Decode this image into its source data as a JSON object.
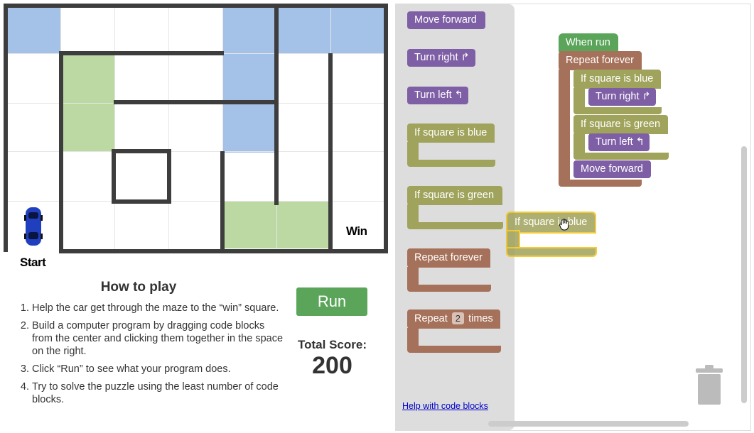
{
  "maze": {
    "start_label": "Start",
    "win_label": "Win",
    "colors": {
      "blue": "#a4c2e8",
      "green": "#bcd9a3",
      "wall": "#3d3d3d",
      "car": "#1f3fbf"
    }
  },
  "instructions": {
    "title": "How to play",
    "steps": [
      "Help the car get through the maze to the “win” square.",
      "Build a computer program by dragging code blocks from the center and clicking them together in the space on the right.",
      "Click “Run” to see what your program does.",
      "Try to solve the puzzle using the least number of code blocks."
    ]
  },
  "run_button": "Run",
  "score": {
    "label": "Total Score:",
    "value": "200"
  },
  "toolbox": {
    "move_forward": "Move forward",
    "turn_right": "Turn right ↱",
    "turn_left": "Turn left ↰",
    "if_blue": "If square is blue",
    "if_green": "If square is green",
    "repeat_forever": "Repeat forever",
    "repeat_prefix": "Repeat",
    "repeat_count": "2",
    "repeat_suffix": "times",
    "help_link": "Help with code blocks"
  },
  "program": {
    "when_run": "When run",
    "repeat_forever": "Repeat forever",
    "if_blue": "If square is blue",
    "turn_right": "Turn right ↱",
    "if_green": "If square is green",
    "turn_left": "Turn left ↰",
    "move_forward": "Move forward"
  },
  "dragging_block": "If square is blue"
}
